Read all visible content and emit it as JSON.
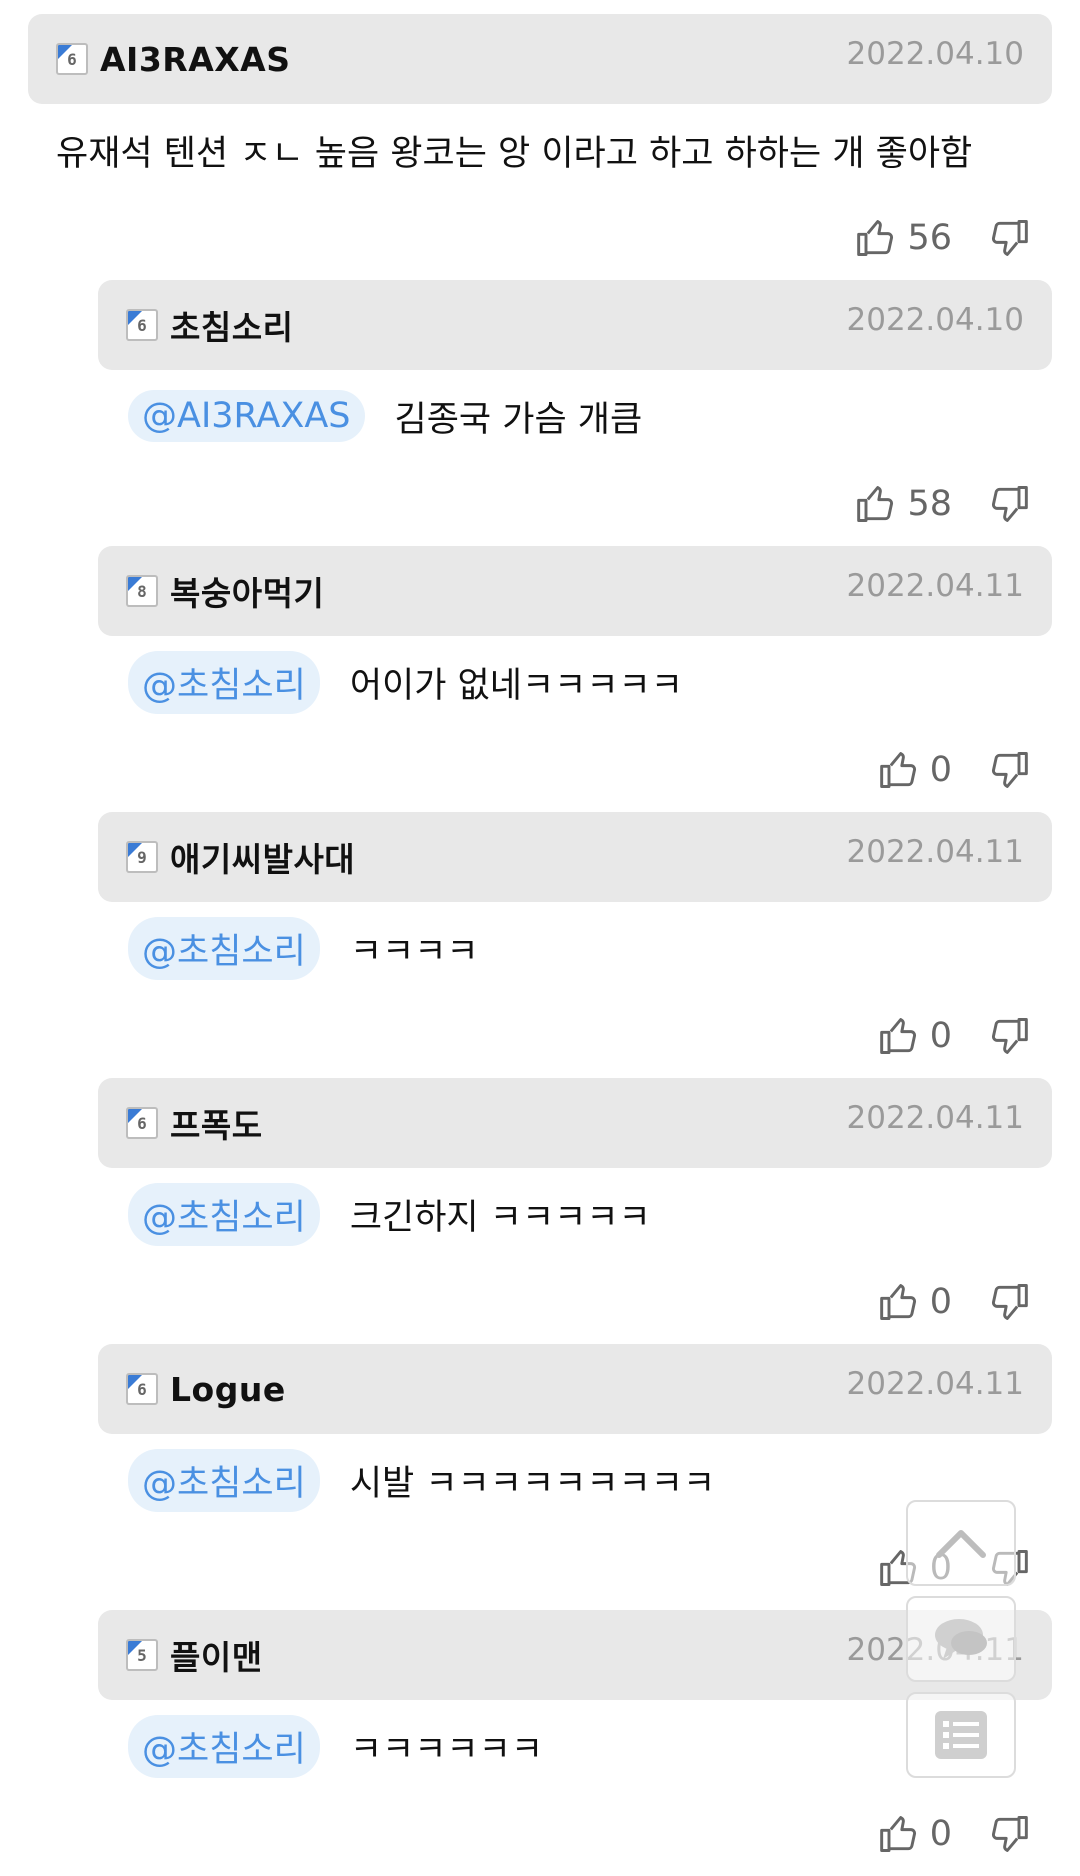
{
  "comments": [
    {
      "type": "top",
      "level": "6",
      "nickname": "AI3RAXAS",
      "date": "2022.04.10",
      "mention": "",
      "text": "유재석 텐션 ㅈㄴ 높음 왕코는 앙 이라고 하고 하하는 개 좋아함",
      "likes": "56"
    },
    {
      "type": "reply",
      "level": "6",
      "nickname": "초침소리",
      "date": "2022.04.10",
      "mention": "@AI3RAXAS",
      "text": "김종국 가슴 개큼",
      "likes": "58"
    },
    {
      "type": "reply",
      "level": "8",
      "nickname": "복숭아먹기",
      "date": "2022.04.11",
      "mention": "@초침소리",
      "text": "어이가 없네ㅋㅋㅋㅋㅋ",
      "likes": "0"
    },
    {
      "type": "reply",
      "level": "9",
      "nickname": "애기씨발사대",
      "date": "2022.04.11",
      "mention": "@초침소리",
      "text": "ㅋㅋㅋㅋ",
      "likes": "0"
    },
    {
      "type": "reply",
      "level": "6",
      "nickname": "프폭도",
      "date": "2022.04.11",
      "mention": "@초침소리",
      "text": "크긴하지 ㅋㅋㅋㅋㅋ",
      "likes": "0"
    },
    {
      "type": "reply",
      "level": "6",
      "nickname": "Logue",
      "date": "2022.04.11",
      "mention": "@초침소리",
      "text": "시발 ㅋㅋㅋㅋㅋㅋㅋㅋㅋ",
      "likes": "0"
    },
    {
      "type": "reply",
      "level": "5",
      "nickname": "플이맨",
      "date": "2022.04.11",
      "mention": "@초침소리",
      "text": "ㅋㅋㅋㅋㅋㅋ",
      "likes": "0"
    }
  ],
  "icons": {
    "like": "thumbs-up-icon",
    "dislike": "thumbs-down-icon",
    "scroll_top": "chevron-up-icon",
    "comments": "comment-bubble-icon",
    "list": "list-icon"
  },
  "colors": {
    "header_bg": "#e8e8e8",
    "mention_bg": "#e6f1fb",
    "mention_text": "#4a90e2",
    "level_badge": "#3a7bd5",
    "date_text": "#9a9a9a"
  }
}
